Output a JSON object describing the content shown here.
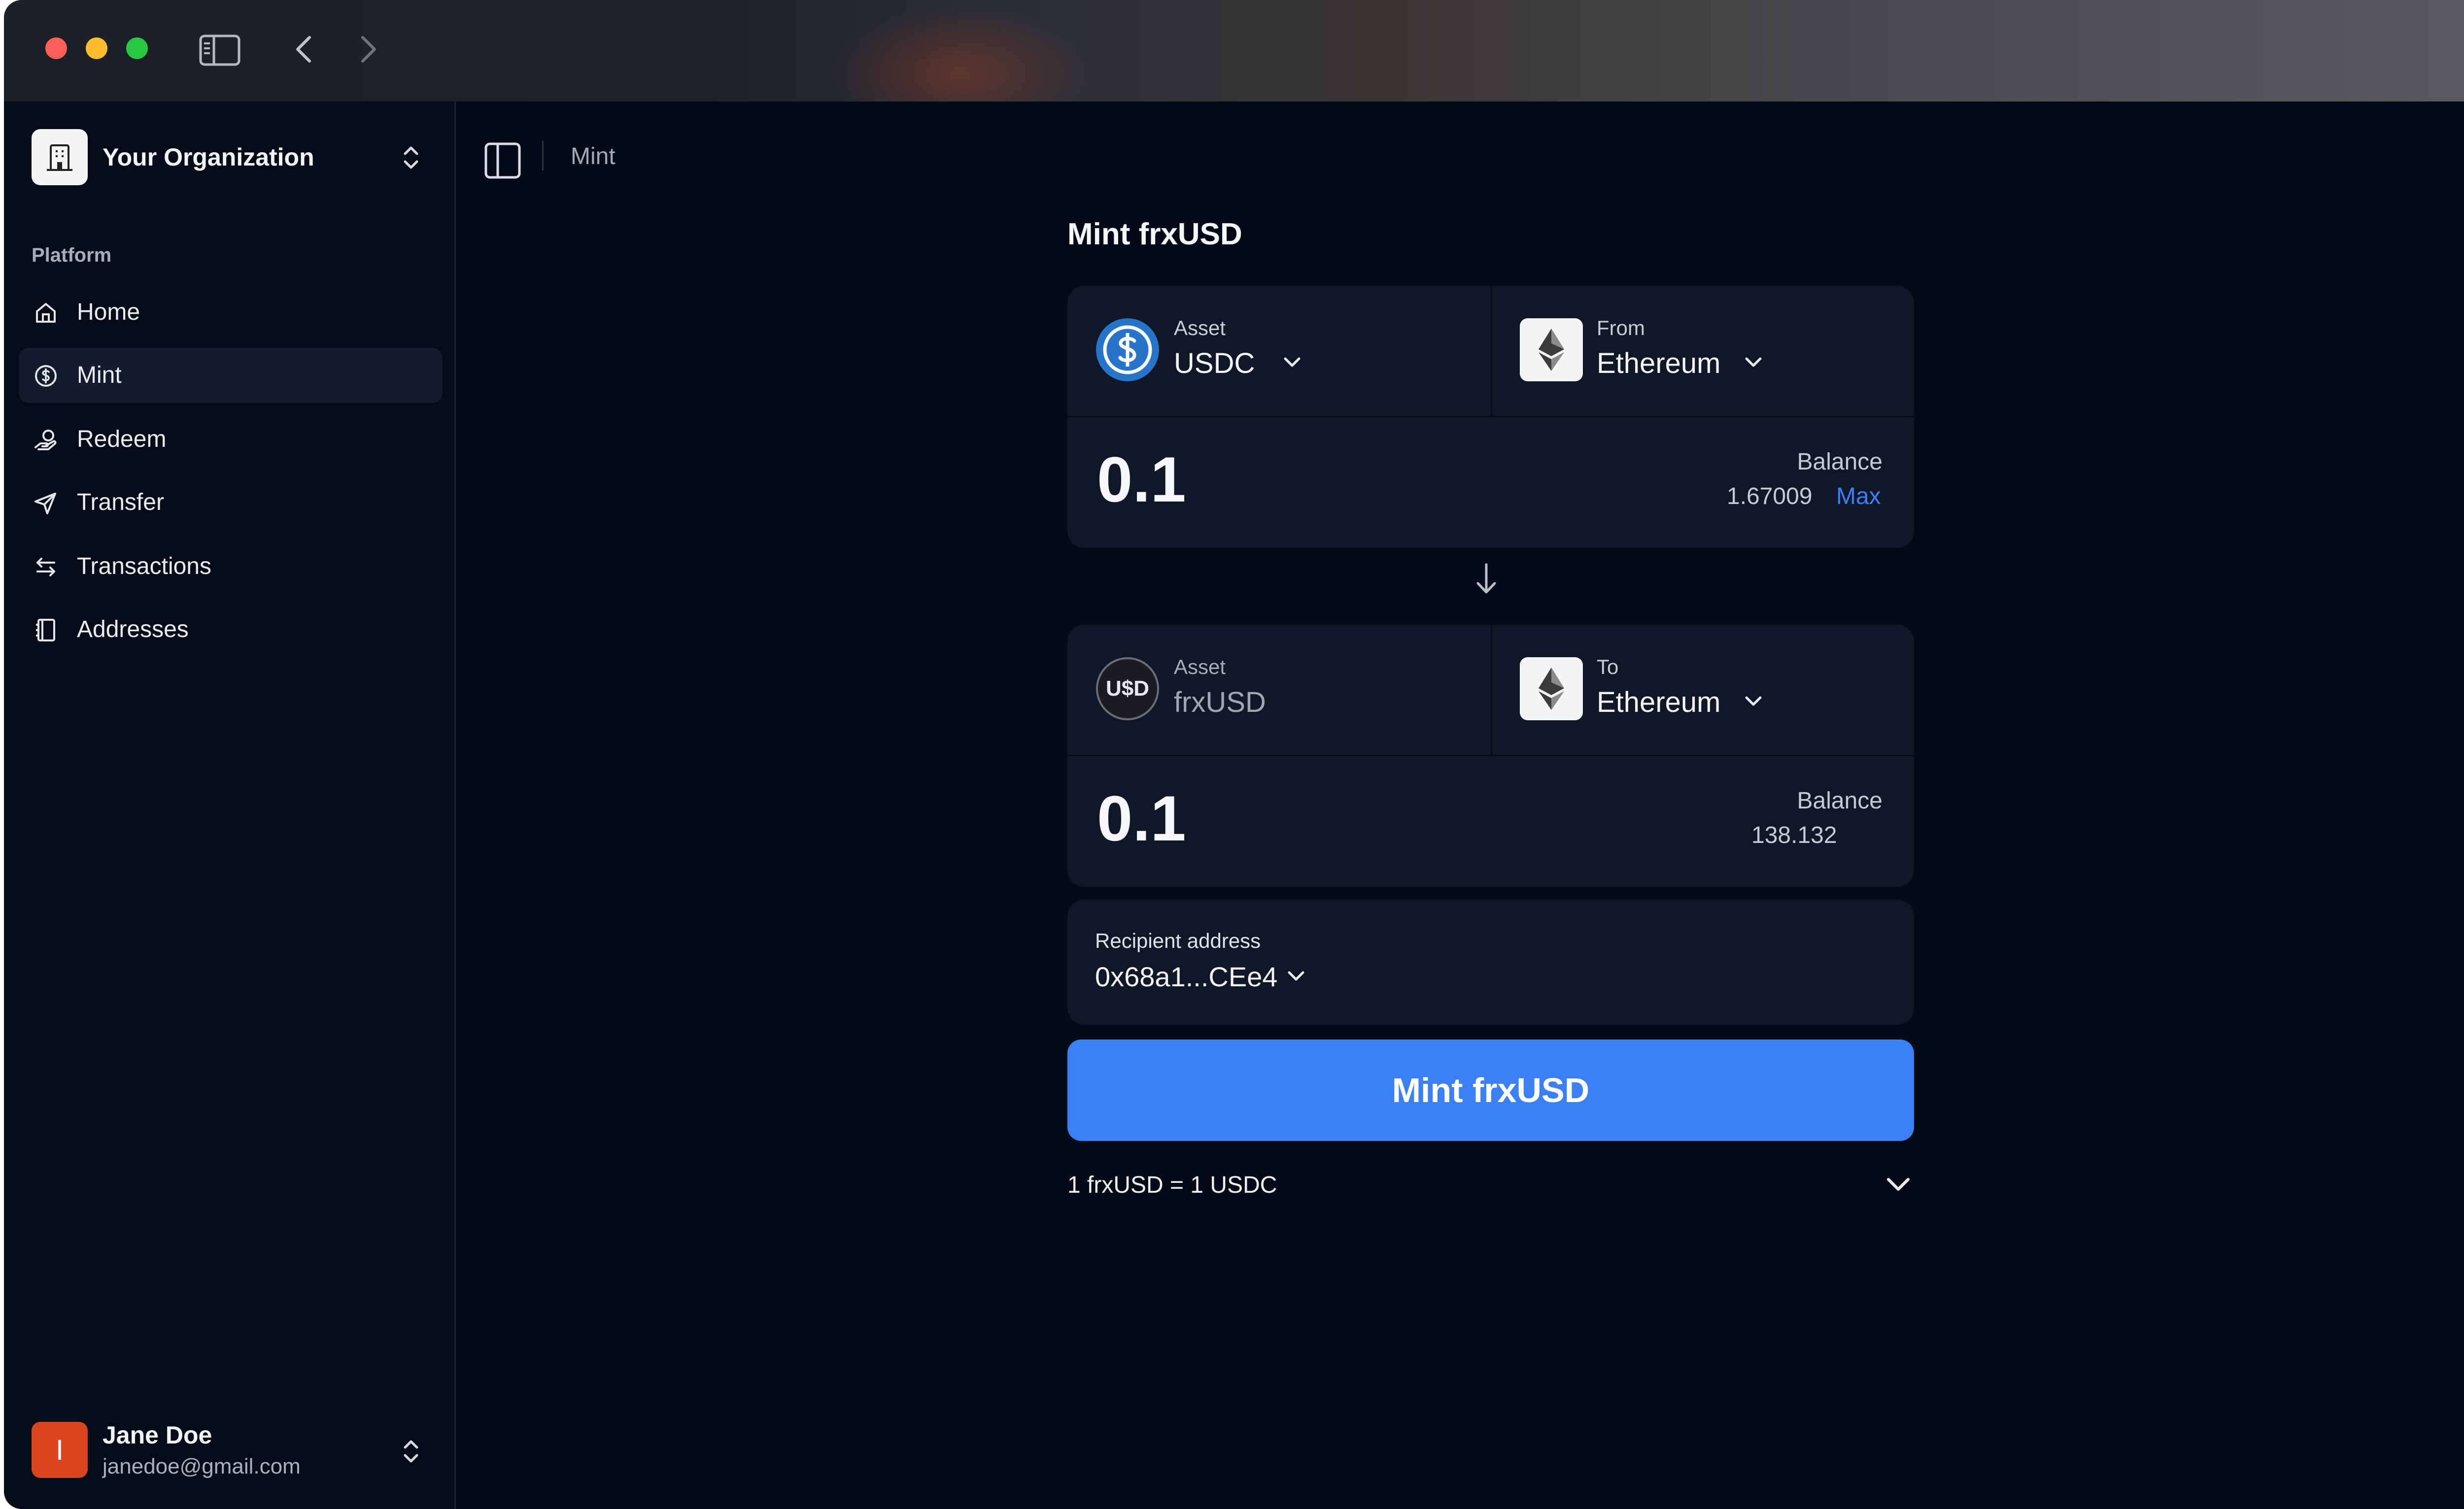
{
  "window": {
    "traffic_lights": {
      "close": "#ff5f57",
      "minimize": "#febc2e",
      "maximize": "#28c840"
    }
  },
  "sidebar": {
    "org_name": "Your Organization",
    "section_label": "Platform",
    "items": [
      {
        "label": "Home",
        "icon": "home-icon",
        "active": false
      },
      {
        "label": "Mint",
        "icon": "dollar-circle-icon",
        "active": true
      },
      {
        "label": "Redeem",
        "icon": "redeem-icon",
        "active": false
      },
      {
        "label": "Transfer",
        "icon": "send-icon",
        "active": false
      },
      {
        "label": "Transactions",
        "icon": "arrows-left-right-icon",
        "active": false
      },
      {
        "label": "Addresses",
        "icon": "address-book-icon",
        "active": false
      }
    ],
    "user": {
      "initial": "I",
      "name": "Jane Doe",
      "email": "janedoe@gmail.com"
    }
  },
  "main": {
    "breadcrumb": "Mint",
    "title": "Mint frxUSD",
    "from_card": {
      "asset_label": "Asset",
      "asset_value": "USDC",
      "chain_label": "From",
      "chain_value": "Ethereum",
      "amount": "0.1",
      "balance_label": "Balance",
      "balance_value": "1.67009",
      "max_label": "Max"
    },
    "to_card": {
      "asset_label": "Asset",
      "asset_value": "frxUSD",
      "asset_icon_text": "U$D",
      "chain_label": "To",
      "chain_value": "Ethereum",
      "amount": "0.1",
      "balance_label": "Balance",
      "balance_value": "138.132"
    },
    "recipient": {
      "label": "Recipient address",
      "value": "0x68a1...CEe4"
    },
    "mint_button": "Mint frxUSD",
    "rate": "1 frxUSD = 1 USDC",
    "accent": "#3b7ff5"
  }
}
